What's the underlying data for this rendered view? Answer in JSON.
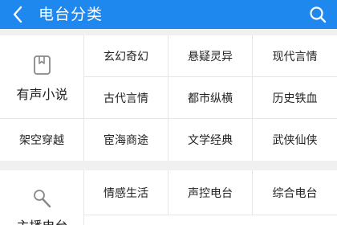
{
  "header": {
    "title": "电台分类",
    "background": "#1e88ee",
    "back_icon": "chevron-left-icon",
    "search_icon": "search-icon"
  },
  "sections": [
    {
      "name": "有声小说",
      "icon": "book-icon",
      "items": [
        "玄幻奇幻",
        "悬疑灵异",
        "现代言情",
        "古代言情",
        "都市纵横",
        "历史铁血",
        "架空穿越",
        "宦海商途",
        "文学经典",
        "武侠仙侠"
      ]
    },
    {
      "name": "主播电台",
      "icon": "microphone-icon",
      "items": [
        "情感生活",
        "声控电台",
        "综合电台"
      ]
    }
  ]
}
